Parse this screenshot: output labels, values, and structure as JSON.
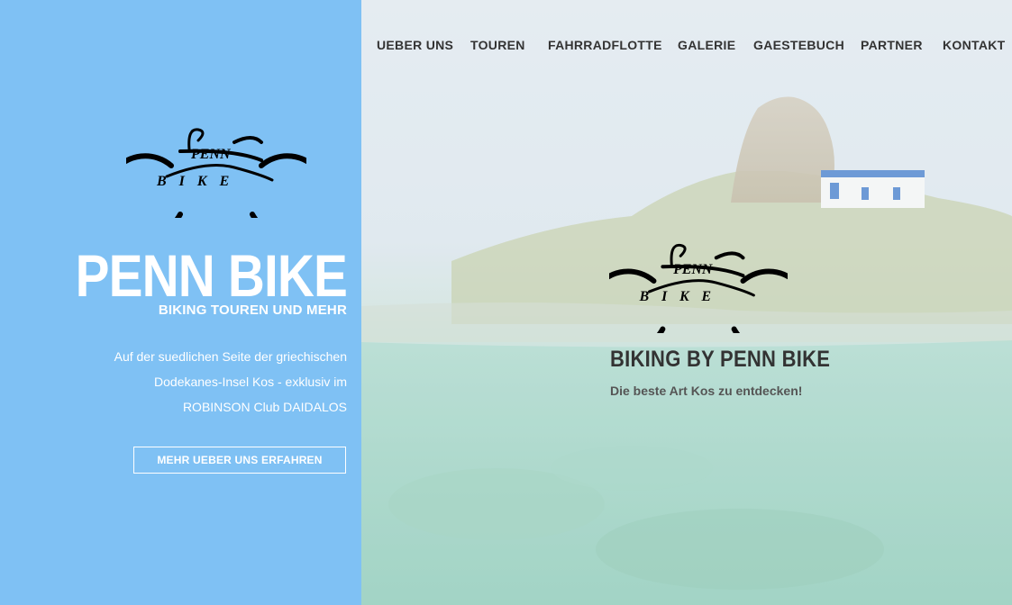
{
  "nav": {
    "items": [
      {
        "label": "UEBER UNS"
      },
      {
        "label": "TOUREN"
      },
      {
        "label": "FAHRRADFLOTTE"
      },
      {
        "label": "GALERIE"
      },
      {
        "label": "GAESTEBUCH"
      },
      {
        "label": "PARTNER"
      },
      {
        "label": "KONTAKT"
      }
    ]
  },
  "sidebar": {
    "logo_icon": "penn-bike-logo",
    "title": "PENN BIKE",
    "subtitle": "BIKING TOUREN UND MEHR",
    "intro_lines": [
      "Auf der suedlichen Seite der griechischen",
      "Dodekanes-Insel Kos - exklusiv im",
      "ROBINSON Club DAIDALOS"
    ],
    "cta_label": "MEHR UEBER UNS ERFAHREN"
  },
  "hero": {
    "logo_icon": "penn-bike-logo",
    "title": "BIKING BY PENN BIKE",
    "subtitle": "Die beste Art Kos zu entdecken!"
  },
  "colors": {
    "sidebar_bg": "#7fc1f4",
    "nav_text": "#333333",
    "hero_title": "#333333",
    "white": "#ffffff"
  }
}
